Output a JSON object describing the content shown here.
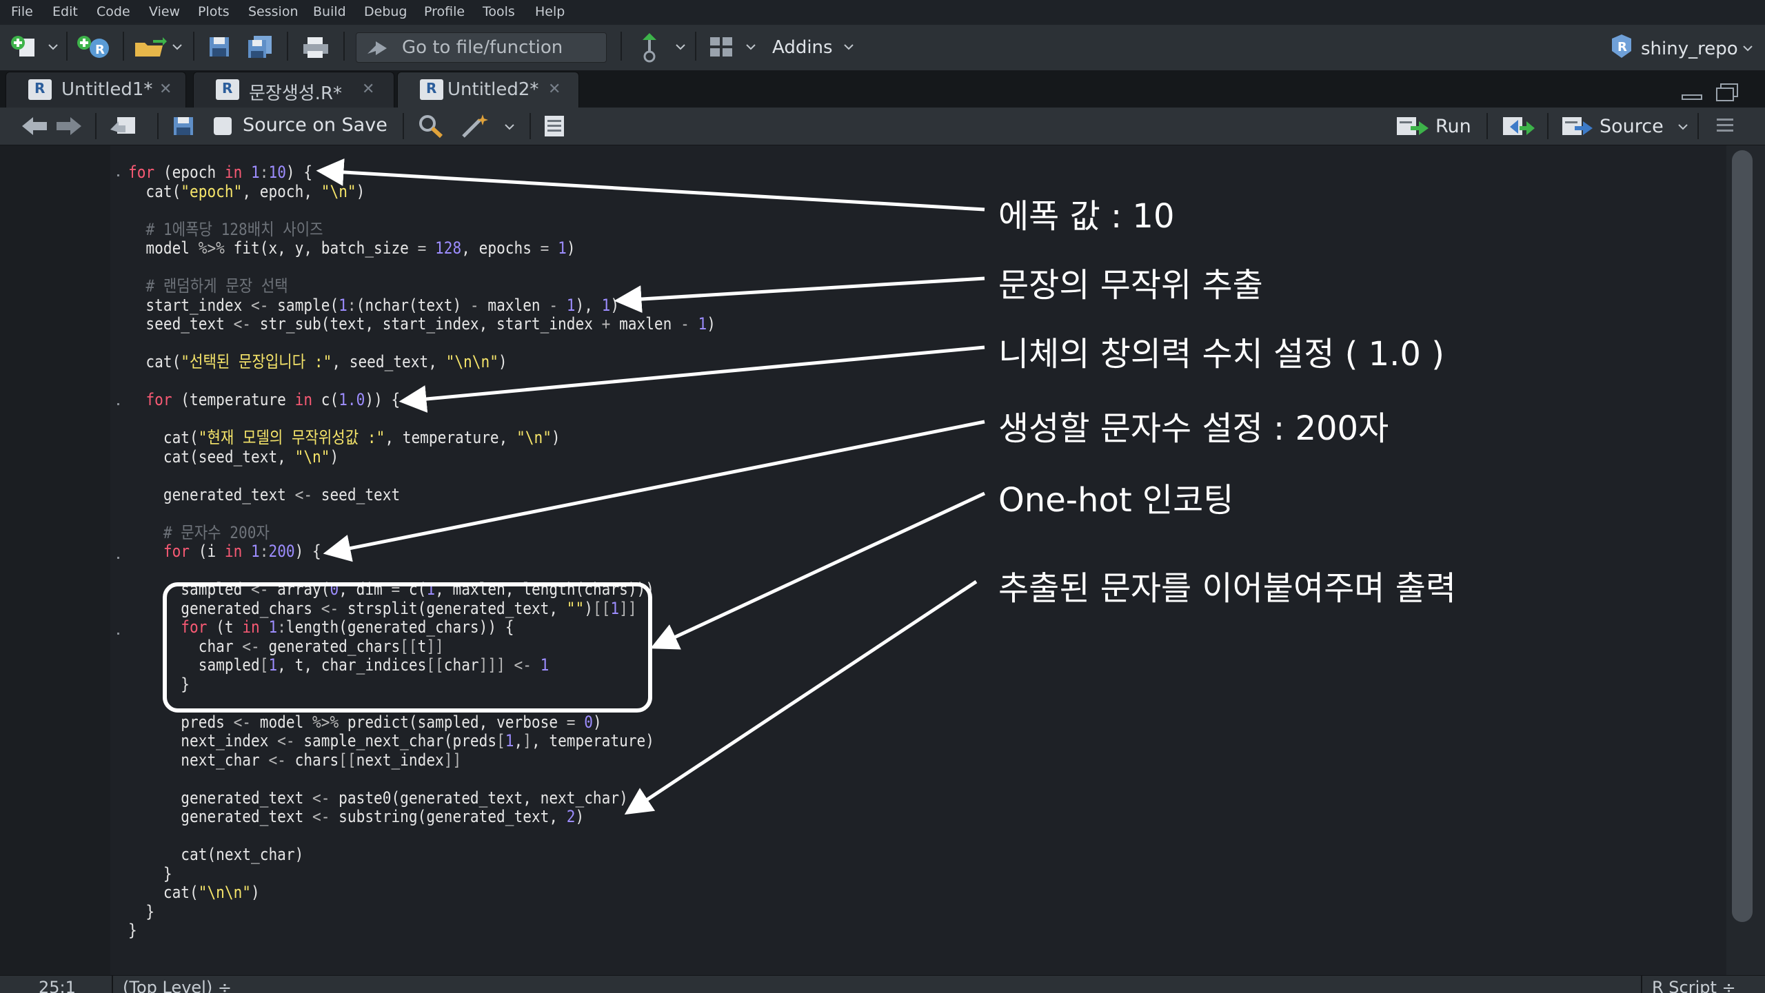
{
  "menu": [
    "File",
    "Edit",
    "Code",
    "View",
    "Plots",
    "Session",
    "Build",
    "Debug",
    "Profile",
    "Tools",
    "Help"
  ],
  "toolbar": {
    "goto_label": "Go to file/function",
    "addins_label": "Addins",
    "project_label": "shiny_repo"
  },
  "tabs": [
    {
      "label": "Untitled1*"
    },
    {
      "label": "문장생성.R*"
    },
    {
      "label": "Untitled2*"
    }
  ],
  "editor_toolbar": {
    "source_on_save": "Source on Save",
    "run_label": "Run",
    "source_label": "Source"
  },
  "code_lines": [
    "for (epoch in 1:10) {",
    "  cat(\"epoch\", epoch, \"\\n\")",
    "",
    "  # 1에폭당 128배치 사이즈",
    "  model %>% fit(x, y, batch_size = 128, epochs = 1)",
    "",
    "  # 랜덤하게 문장 선택",
    "  start_index <- sample(1:(nchar(text) - maxlen - 1), 1)",
    "  seed_text <- str_sub(text, start_index, start_index + maxlen - 1)",
    "",
    "  cat(\"선택된 문장입니다 :\", seed_text, \"\\n\\n\")",
    "",
    "  for (temperature in c(1.0)) {",
    "",
    "    cat(\"현재 모델의 무작위성값 :\", temperature, \"\\n\")",
    "    cat(seed_text, \"\\n\")",
    "",
    "    generated_text <- seed_text",
    "",
    "    # 문자수 200자",
    "    for (i in 1:200) {",
    "",
    "      sampled <- array(0, dim = c(1, maxlen, length(chars)))",
    "      generated_chars <- strsplit(generated_text, \"\")[[1]]",
    "      for (t in 1:length(generated_chars)) {",
    "        char <- generated_chars[[t]]",
    "        sampled[1, t, char_indices[[char]]] <- 1",
    "      }",
    "",
    "      preds <- model %>% predict(sampled, verbose = 0)",
    "      next_index <- sample_next_char(preds[1,], temperature)",
    "      next_char <- chars[[next_index]]",
    "",
    "      generated_text <- paste0(generated_text, next_char)",
    "      generated_text <- substring(generated_text, 2)",
    "",
    "      cat(next_char)",
    "    }",
    "    cat(\"\\n\\n\")",
    "  }",
    "}"
  ],
  "annotations": [
    "에폭 값 :  10",
    "문장의 무작위 추출",
    "니체의 창의력 수치 설정 ( 1.0 )",
    "생성할 문자수 설정 : 200자",
    "One-hot 인코팅",
    "추출된 문자를 이어붙여주며 출력"
  ],
  "status": {
    "position": "25:1",
    "scope": "(Top Level) ÷",
    "file_type": "R Script ÷"
  }
}
